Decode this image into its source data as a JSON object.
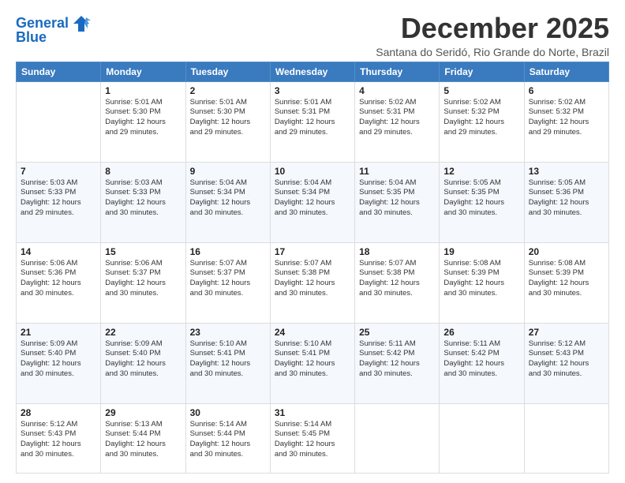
{
  "logo": {
    "line1": "General",
    "line2": "Blue"
  },
  "title": "December 2025",
  "subtitle": "Santana do Seridó, Rio Grande do Norte, Brazil",
  "headers": [
    "Sunday",
    "Monday",
    "Tuesday",
    "Wednesday",
    "Thursday",
    "Friday",
    "Saturday"
  ],
  "weeks": [
    [
      {
        "day": "",
        "info": ""
      },
      {
        "day": "1",
        "info": "Sunrise: 5:01 AM\nSunset: 5:30 PM\nDaylight: 12 hours\nand 29 minutes."
      },
      {
        "day": "2",
        "info": "Sunrise: 5:01 AM\nSunset: 5:30 PM\nDaylight: 12 hours\nand 29 minutes."
      },
      {
        "day": "3",
        "info": "Sunrise: 5:01 AM\nSunset: 5:31 PM\nDaylight: 12 hours\nand 29 minutes."
      },
      {
        "day": "4",
        "info": "Sunrise: 5:02 AM\nSunset: 5:31 PM\nDaylight: 12 hours\nand 29 minutes."
      },
      {
        "day": "5",
        "info": "Sunrise: 5:02 AM\nSunset: 5:32 PM\nDaylight: 12 hours\nand 29 minutes."
      },
      {
        "day": "6",
        "info": "Sunrise: 5:02 AM\nSunset: 5:32 PM\nDaylight: 12 hours\nand 29 minutes."
      }
    ],
    [
      {
        "day": "7",
        "info": "Sunrise: 5:03 AM\nSunset: 5:33 PM\nDaylight: 12 hours\nand 29 minutes."
      },
      {
        "day": "8",
        "info": "Sunrise: 5:03 AM\nSunset: 5:33 PM\nDaylight: 12 hours\nand 30 minutes."
      },
      {
        "day": "9",
        "info": "Sunrise: 5:04 AM\nSunset: 5:34 PM\nDaylight: 12 hours\nand 30 minutes."
      },
      {
        "day": "10",
        "info": "Sunrise: 5:04 AM\nSunset: 5:34 PM\nDaylight: 12 hours\nand 30 minutes."
      },
      {
        "day": "11",
        "info": "Sunrise: 5:04 AM\nSunset: 5:35 PM\nDaylight: 12 hours\nand 30 minutes."
      },
      {
        "day": "12",
        "info": "Sunrise: 5:05 AM\nSunset: 5:35 PM\nDaylight: 12 hours\nand 30 minutes."
      },
      {
        "day": "13",
        "info": "Sunrise: 5:05 AM\nSunset: 5:36 PM\nDaylight: 12 hours\nand 30 minutes."
      }
    ],
    [
      {
        "day": "14",
        "info": "Sunrise: 5:06 AM\nSunset: 5:36 PM\nDaylight: 12 hours\nand 30 minutes."
      },
      {
        "day": "15",
        "info": "Sunrise: 5:06 AM\nSunset: 5:37 PM\nDaylight: 12 hours\nand 30 minutes."
      },
      {
        "day": "16",
        "info": "Sunrise: 5:07 AM\nSunset: 5:37 PM\nDaylight: 12 hours\nand 30 minutes."
      },
      {
        "day": "17",
        "info": "Sunrise: 5:07 AM\nSunset: 5:38 PM\nDaylight: 12 hours\nand 30 minutes."
      },
      {
        "day": "18",
        "info": "Sunrise: 5:07 AM\nSunset: 5:38 PM\nDaylight: 12 hours\nand 30 minutes."
      },
      {
        "day": "19",
        "info": "Sunrise: 5:08 AM\nSunset: 5:39 PM\nDaylight: 12 hours\nand 30 minutes."
      },
      {
        "day": "20",
        "info": "Sunrise: 5:08 AM\nSunset: 5:39 PM\nDaylight: 12 hours\nand 30 minutes."
      }
    ],
    [
      {
        "day": "21",
        "info": "Sunrise: 5:09 AM\nSunset: 5:40 PM\nDaylight: 12 hours\nand 30 minutes."
      },
      {
        "day": "22",
        "info": "Sunrise: 5:09 AM\nSunset: 5:40 PM\nDaylight: 12 hours\nand 30 minutes."
      },
      {
        "day": "23",
        "info": "Sunrise: 5:10 AM\nSunset: 5:41 PM\nDaylight: 12 hours\nand 30 minutes."
      },
      {
        "day": "24",
        "info": "Sunrise: 5:10 AM\nSunset: 5:41 PM\nDaylight: 12 hours\nand 30 minutes."
      },
      {
        "day": "25",
        "info": "Sunrise: 5:11 AM\nSunset: 5:42 PM\nDaylight: 12 hours\nand 30 minutes."
      },
      {
        "day": "26",
        "info": "Sunrise: 5:11 AM\nSunset: 5:42 PM\nDaylight: 12 hours\nand 30 minutes."
      },
      {
        "day": "27",
        "info": "Sunrise: 5:12 AM\nSunset: 5:43 PM\nDaylight: 12 hours\nand 30 minutes."
      }
    ],
    [
      {
        "day": "28",
        "info": "Sunrise: 5:12 AM\nSunset: 5:43 PM\nDaylight: 12 hours\nand 30 minutes."
      },
      {
        "day": "29",
        "info": "Sunrise: 5:13 AM\nSunset: 5:44 PM\nDaylight: 12 hours\nand 30 minutes."
      },
      {
        "day": "30",
        "info": "Sunrise: 5:14 AM\nSunset: 5:44 PM\nDaylight: 12 hours\nand 30 minutes."
      },
      {
        "day": "31",
        "info": "Sunrise: 5:14 AM\nSunset: 5:45 PM\nDaylight: 12 hours\nand 30 minutes."
      },
      {
        "day": "",
        "info": ""
      },
      {
        "day": "",
        "info": ""
      },
      {
        "day": "",
        "info": ""
      }
    ]
  ]
}
